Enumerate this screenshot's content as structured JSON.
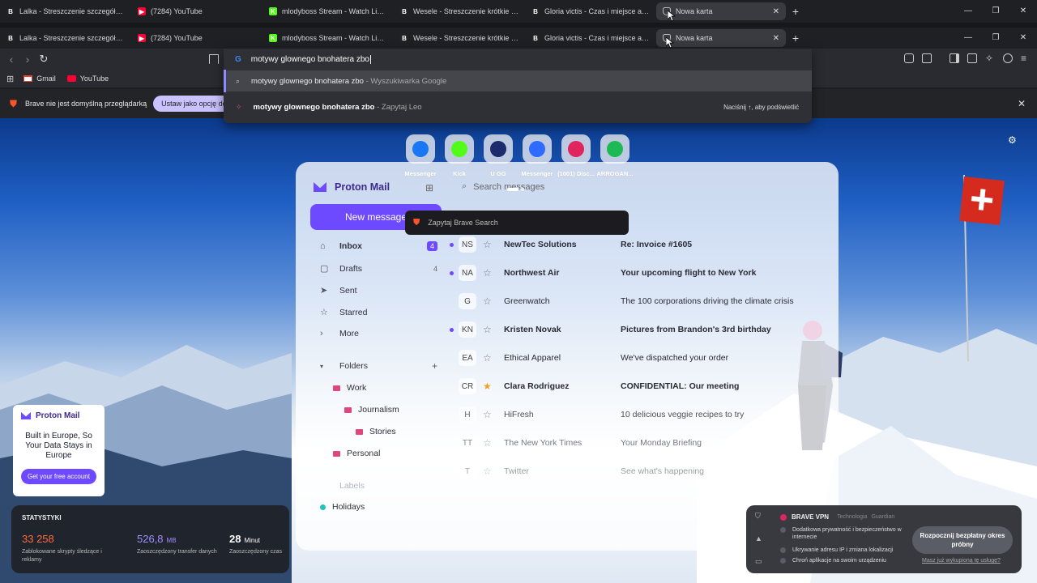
{
  "tabs": [
    {
      "title": "Lalka - Streszczenie szczegółowe - Bi",
      "favicon": "B",
      "fav_color": "#222"
    },
    {
      "title": "(7284) YouTube",
      "favicon": "▶",
      "fav_color": "#ff0033"
    },
    {
      "title": "mlodyboss Stream - Watch Live on K",
      "favicon": "K",
      "fav_color": "#53fc18"
    },
    {
      "title": "Wesele - Streszczenie krótkie - Stanis",
      "favicon": "B",
      "fav_color": "#222"
    },
    {
      "title": "Gloria victis - Czas i miejsce akcji - Bi",
      "favicon": "B",
      "fav_color": "#222"
    },
    {
      "title": "Nowa karta",
      "favicon": "shield",
      "fav_color": "#bbb"
    }
  ],
  "window_controls": {
    "minimize": "—",
    "restore": "❐",
    "close": "✕"
  },
  "omnibox": {
    "value": "motywy glownego bnohatera zbo",
    "suggestions": [
      {
        "bold": "motywy glownego bnohatera zbo",
        "suffix": " - Wyszukiwarka Google"
      },
      {
        "bold": "motywy glownego bnohatera zbo",
        "suffix": " - Zapytaj Leo",
        "hint": "Naciśnij ↑, aby podświetlić"
      }
    ]
  },
  "bookmarks": [
    {
      "label": "Gmail",
      "icon": "gmail-icon"
    },
    {
      "label": "YouTube",
      "icon": "youtube-icon"
    }
  ],
  "notice": {
    "text": "Brave nie jest domyślną przeglądarką",
    "button": "Ustaw jako opcję do"
  },
  "speed_dial": [
    {
      "label": "Messenger",
      "icon": "facebook-icon",
      "color": "#1877f2"
    },
    {
      "label": "Kick",
      "icon": "kick-icon",
      "color": "#53fc18"
    },
    {
      "label": "U GG",
      "icon": "ugg-icon",
      "color": "#1d2a6b"
    },
    {
      "label": "Messenger",
      "icon": "messenger-icon",
      "color": "#2f6bff"
    },
    {
      "label": "(1001) Disc...",
      "icon": "discord-icon",
      "color": "#e0245e"
    },
    {
      "label": "ARROGAN...",
      "icon": "spotify-icon",
      "color": "#1db954"
    }
  ],
  "brave_search_pill": "Zapytaj Brave Search",
  "proton": {
    "logo": "Proton Mail",
    "new_message": "New message",
    "search_placeholder": "Search messages",
    "nav": [
      {
        "label": "Inbox",
        "count": "4"
      },
      {
        "label": "Drafts",
        "count": "4"
      },
      {
        "label": "Sent",
        "count": ""
      },
      {
        "label": "Starred",
        "count": ""
      },
      {
        "label": "More",
        "count": ""
      }
    ],
    "folders_label": "Folders",
    "folders": [
      {
        "label": "Work",
        "color": "#e0457b"
      },
      {
        "label": "Journalism",
        "color": "#e0457b"
      },
      {
        "label": "Stories",
        "color": "#e0457b"
      },
      {
        "label": "Personal",
        "color": "#e0457b"
      }
    ],
    "labels_label": "Labels",
    "labels": [
      {
        "label": "Holidays",
        "color": "#1fc3b8"
      }
    ],
    "emails": [
      {
        "initials": "NS",
        "sender": "NewTec Solutions",
        "subject": "Re: Invoice #1605",
        "unread": true,
        "starred": false
      },
      {
        "initials": "NA",
        "sender": "Northwest Air",
        "subject": "Your upcoming flight to New York",
        "unread": true,
        "starred": false
      },
      {
        "initials": "G",
        "sender": "Greenwatch",
        "subject": "The 100 corporations driving the climate crisis",
        "unread": false,
        "starred": false
      },
      {
        "initials": "KN",
        "sender": "Kristen Novak",
        "subject": "Pictures from Brandon's 3rd birthday",
        "unread": true,
        "starred": false
      },
      {
        "initials": "EA",
        "sender": "Ethical Apparel",
        "subject": "We've dispatched your order",
        "unread": false,
        "starred": false
      },
      {
        "initials": "CR",
        "sender": "Clara Rodriguez",
        "subject": "CONFIDENTIAL: Our meeting",
        "unread": false,
        "starred": true
      },
      {
        "initials": "H",
        "sender": "HiFresh",
        "subject": "10 delicious veggie recipes to try",
        "unread": false,
        "starred": false
      },
      {
        "initials": "TT",
        "sender": "The New York Times",
        "subject": "Your Monday Briefing",
        "unread": false,
        "starred": false
      },
      {
        "initials": "T",
        "sender": "Twitter",
        "subject": "See what's happening",
        "unread": false,
        "starred": false
      }
    ]
  },
  "proton_ad": {
    "logo": "Proton Mail",
    "headline": "Built in Europe, So Your Data Stays in Europe",
    "cta": "Get your free account"
  },
  "stats": {
    "title": "STATYSTYKI",
    "items": [
      {
        "value": "33 258",
        "unit": "",
        "label": "Zablokowane skrypty śledzące i reklamy",
        "color": "#ff6a3d"
      },
      {
        "value": "526,8",
        "unit": "MB",
        "label": "Zaoszczędzony transfer danych",
        "color": "#a58cff"
      },
      {
        "value": "28",
        "unit": "Minut",
        "label": "Zaoszczędzony czas",
        "color": "#ffffff"
      }
    ]
  },
  "vpn": {
    "title": "BRAVE VPN",
    "tech": "Technologia",
    "tech_brand": "Guardian",
    "features": [
      "Dodatkowa prywatność i bezpieczeństwo w internecie",
      "Ukrywanie adresu IP i zmiana lokalizacji",
      "Chroń aplikacje na swoim urządzeniu"
    ],
    "cta": "Rozpocznij bezpłatny okres próbny",
    "link": "Masz już wykupioną tę usługę?"
  }
}
